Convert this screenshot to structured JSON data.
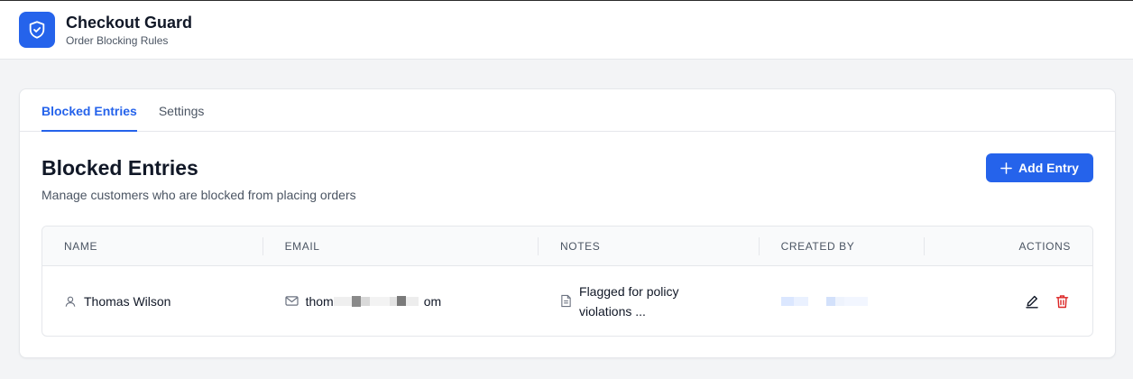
{
  "app": {
    "title": "Checkout Guard",
    "subtitle": "Order Blocking Rules",
    "logo_icon": "shield-check-icon",
    "accent": "#2563eb"
  },
  "tabs": [
    {
      "label": "Blocked Entries",
      "active": true
    },
    {
      "label": "Settings",
      "active": false
    }
  ],
  "section": {
    "title": "Blocked Entries",
    "subtitle": "Manage customers who are blocked from placing orders",
    "add_button": "Add Entry"
  },
  "table": {
    "headers": [
      "NAME",
      "EMAIL",
      "NOTES",
      "CREATED BY",
      "ACTIONS"
    ],
    "rows": [
      {
        "name": "Thomas Wilson",
        "email_start": "thom",
        "email_end": "om",
        "notes": "Flagged for policy violations ..."
      }
    ]
  },
  "colors": {
    "danger": "#dc2626",
    "header_bg": "#f9fafb",
    "border": "#e5e7eb"
  }
}
